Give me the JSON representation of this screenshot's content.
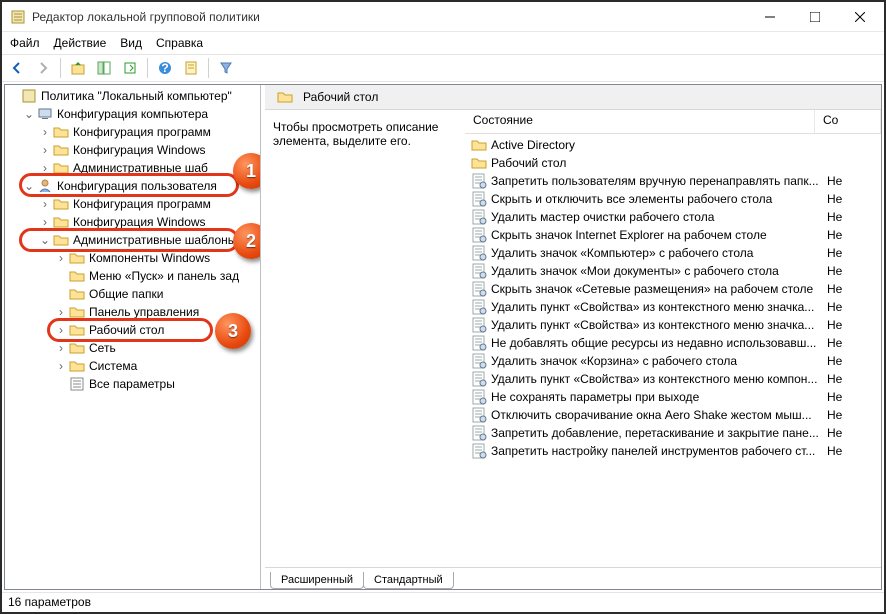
{
  "window": {
    "title": "Редактор локальной групповой политики"
  },
  "menu": {
    "file": "Файл",
    "action": "Действие",
    "view": "Вид",
    "help": "Справка"
  },
  "tree": {
    "root": "Политика \"Локальный компьютер\"",
    "computer_config": "Конфигурация компьютера",
    "comp_software": "Конфигурация программ",
    "comp_windows": "Конфигурация Windows",
    "comp_admin": "Административные шаб",
    "user_config": "Конфигурация пользователя",
    "user_software": "Конфигурация программ",
    "user_windows": "Конфигурация Windows",
    "user_admin": "Административные шаблоны",
    "admin_components": "Компоненты Windows",
    "admin_start": "Меню «Пуск» и панель зад",
    "admin_shared": "Общие папки",
    "admin_controlpanel": "Панель управления",
    "admin_desktop": "Рабочий стол",
    "admin_network": "Сеть",
    "admin_system": "Система",
    "admin_allsettings": "Все параметры"
  },
  "details": {
    "header": "Рабочий стол",
    "desc": "Чтобы просмотреть описание элемента, выделите его.",
    "col_state": "Состояние",
    "col_co": "Со",
    "tabs": {
      "extended": "Расширенный",
      "standard": "Стандартный"
    }
  },
  "items": [
    {
      "name": "Active Directory",
      "type": "folder",
      "val": ""
    },
    {
      "name": "Рабочий стол",
      "type": "folder",
      "val": ""
    },
    {
      "name": "Запретить пользователям вручную перенаправлять папк...",
      "type": "setting",
      "val": "Не"
    },
    {
      "name": "Скрыть и отключить все элементы рабочего стола",
      "type": "setting",
      "val": "Не"
    },
    {
      "name": "Удалить мастер очистки рабочего стола",
      "type": "setting",
      "val": "Не"
    },
    {
      "name": "Скрыть значок Internet Explorer на рабочем столе",
      "type": "setting",
      "val": "Не"
    },
    {
      "name": "Удалить значок «Компьютер» с рабочего стола",
      "type": "setting",
      "val": "Не"
    },
    {
      "name": "Удалить значок «Мои документы» с рабочего стола",
      "type": "setting",
      "val": "Не"
    },
    {
      "name": "Скрыть значок «Сетевые размещения» на рабочем столе",
      "type": "setting",
      "val": "Не"
    },
    {
      "name": "Удалить пункт «Свойства» из контекстного меню значка...",
      "type": "setting",
      "val": "Не"
    },
    {
      "name": "Удалить пункт «Свойства» из контекстного меню значка...",
      "type": "setting",
      "val": "Не"
    },
    {
      "name": "Не добавлять общие ресурсы из недавно использовавш...",
      "type": "setting",
      "val": "Не"
    },
    {
      "name": "Удалить значок «Корзина» с рабочего стола",
      "type": "setting",
      "val": "Не"
    },
    {
      "name": "Удалить пункт «Свойства» из контекстного меню компон...",
      "type": "setting",
      "val": "Не"
    },
    {
      "name": "Не сохранять параметры при выходе",
      "type": "setting",
      "val": "Не"
    },
    {
      "name": "Отключить сворачивание окна Aero Shake жестом мыш...",
      "type": "setting",
      "val": "Не"
    },
    {
      "name": "Запретить добавление, перетаскивание и закрытие пане...",
      "type": "setting",
      "val": "Не"
    },
    {
      "name": "Запретить настройку панелей инструментов рабочего ст...",
      "type": "setting",
      "val": "Не"
    }
  ],
  "status": "16 параметров",
  "callouts": {
    "c1": "1",
    "c2": "2",
    "c3": "3"
  }
}
